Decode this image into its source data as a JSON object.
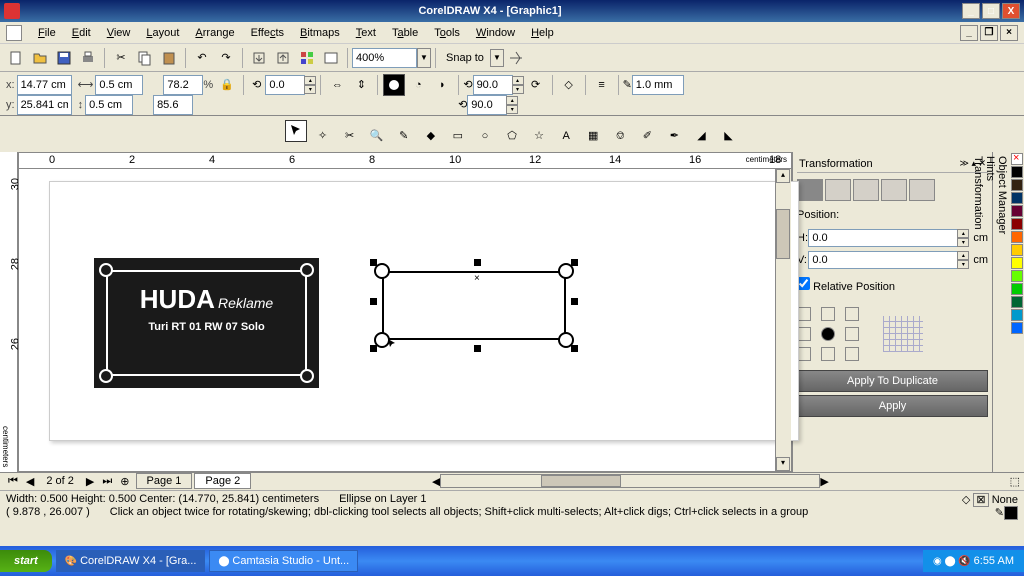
{
  "title": "CorelDRAW X4 - [Graphic1]",
  "menu": [
    "File",
    "Edit",
    "View",
    "Layout",
    "Arrange",
    "Effects",
    "Bitmaps",
    "Text",
    "Table",
    "Tools",
    "Window",
    "Help"
  ],
  "zoom": "400%",
  "snap": "Snap to",
  "prop": {
    "x": "14.77 cm",
    "y": "25.841 cm",
    "w": "0.5 cm",
    "h": "0.5 cm",
    "sx": "78.2",
    "sy": "85.6",
    "rot": "0.0",
    "r1": "90.0",
    "r2": "90.0",
    "out": "1.0 mm"
  },
  "ruler_h": [
    0,
    2,
    4,
    6,
    8,
    10,
    12,
    14,
    16,
    18
  ],
  "ruler_v": [
    30,
    28,
    26
  ],
  "ruler_unit": "centimeters",
  "card": {
    "title": "HUDA",
    "sub": "Reklame",
    "addr": "Turi RT 01 RW 07 Solo"
  },
  "dock": {
    "title": "Transformation",
    "pos": "Position:",
    "h": "0.0",
    "v": "0.0",
    "unit": "cm",
    "rel": "Relative Position",
    "apply_dup": "Apply To Duplicate",
    "apply": "Apply"
  },
  "side_tabs": [
    "Object Manager",
    "Hints",
    "Transformation"
  ],
  "tabs": {
    "count": "2 of 2",
    "p1": "Page 1",
    "p2": "Page 2"
  },
  "status": {
    "dim": "Width: 0.500   Height: 0.500   Center: (14.770, 25.841)   centimeters",
    "layer": "Ellipse on Layer 1",
    "pos": "( 9.878 , 26.007 )",
    "hint": "Click an object twice for rotating/skewing; dbl-clicking tool selects all objects; Shift+click multi-selects; Alt+click digs; Ctrl+click selects in a group",
    "fill": "None"
  },
  "taskbar": {
    "start": "start",
    "t1": "CorelDRAW X4 - [Gra...",
    "t2": "Camtasia Studio - Unt...",
    "time": "6:55 AM"
  },
  "colors": [
    "#ff0000",
    "#800000",
    "#ffff00",
    "#808000",
    "#00ff00",
    "#008000",
    "#00ffff",
    "#008080",
    "#0000ff",
    "#000080",
    "#ff00ff",
    "#800080"
  ]
}
